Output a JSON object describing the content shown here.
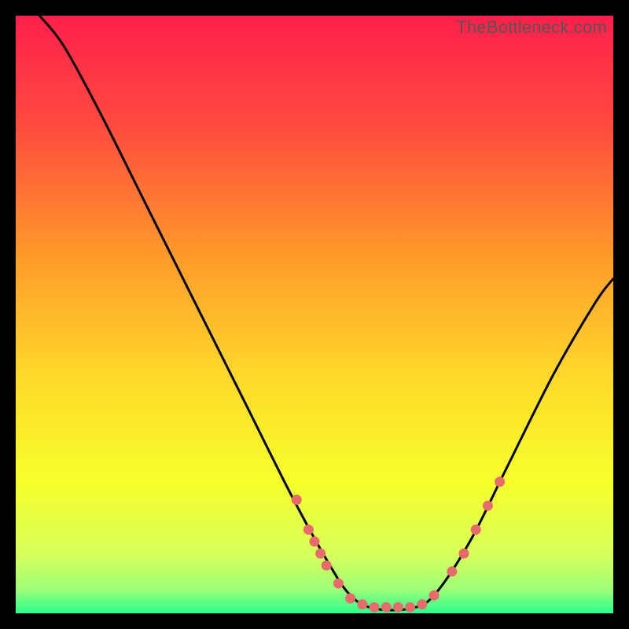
{
  "watermark": "TheBottleneck.com",
  "chart_data": {
    "type": "line",
    "title": "",
    "xlabel": "",
    "ylabel": "",
    "xlim": [
      0,
      100
    ],
    "ylim": [
      0,
      100
    ],
    "gradient_stops": [
      {
        "offset": 0,
        "color": "#ff1f4b"
      },
      {
        "offset": 0.18,
        "color": "#ff4a3f"
      },
      {
        "offset": 0.4,
        "color": "#ff9a2a"
      },
      {
        "offset": 0.6,
        "color": "#ffd82a"
      },
      {
        "offset": 0.78,
        "color": "#f6ff2a"
      },
      {
        "offset": 0.9,
        "color": "#d7ff5a"
      },
      {
        "offset": 0.965,
        "color": "#9bff7a"
      },
      {
        "offset": 1.0,
        "color": "#2bff8a"
      }
    ],
    "curve": [
      {
        "x": 4,
        "y": 100
      },
      {
        "x": 8,
        "y": 95
      },
      {
        "x": 14,
        "y": 84
      },
      {
        "x": 22,
        "y": 68
      },
      {
        "x": 30,
        "y": 52
      },
      {
        "x": 38,
        "y": 36
      },
      {
        "x": 46,
        "y": 20
      },
      {
        "x": 52,
        "y": 9
      },
      {
        "x": 56,
        "y": 3
      },
      {
        "x": 60,
        "y": 0.8
      },
      {
        "x": 66,
        "y": 0.8
      },
      {
        "x": 70,
        "y": 3
      },
      {
        "x": 76,
        "y": 12
      },
      {
        "x": 82,
        "y": 24
      },
      {
        "x": 90,
        "y": 40
      },
      {
        "x": 97,
        "y": 52
      },
      {
        "x": 100,
        "y": 56
      }
    ],
    "dots": [
      {
        "x": 47,
        "y": 19
      },
      {
        "x": 49,
        "y": 14
      },
      {
        "x": 50,
        "y": 12
      },
      {
        "x": 51,
        "y": 10
      },
      {
        "x": 52,
        "y": 8
      },
      {
        "x": 54,
        "y": 5
      },
      {
        "x": 56,
        "y": 2.5
      },
      {
        "x": 58,
        "y": 1.5
      },
      {
        "x": 60,
        "y": 1
      },
      {
        "x": 62,
        "y": 1
      },
      {
        "x": 64,
        "y": 1
      },
      {
        "x": 66,
        "y": 1
      },
      {
        "x": 68,
        "y": 1.5
      },
      {
        "x": 70,
        "y": 3
      },
      {
        "x": 73,
        "y": 7
      },
      {
        "x": 75,
        "y": 10
      },
      {
        "x": 77,
        "y": 14
      },
      {
        "x": 79,
        "y": 18
      },
      {
        "x": 81,
        "y": 22
      }
    ],
    "dot_color": "#e86a6a",
    "curve_color": "#000000",
    "bottom_band": {
      "from_y": 0,
      "to_y": 4,
      "color_top": "#9bff7a",
      "color_bottom": "#2bff8a"
    }
  }
}
